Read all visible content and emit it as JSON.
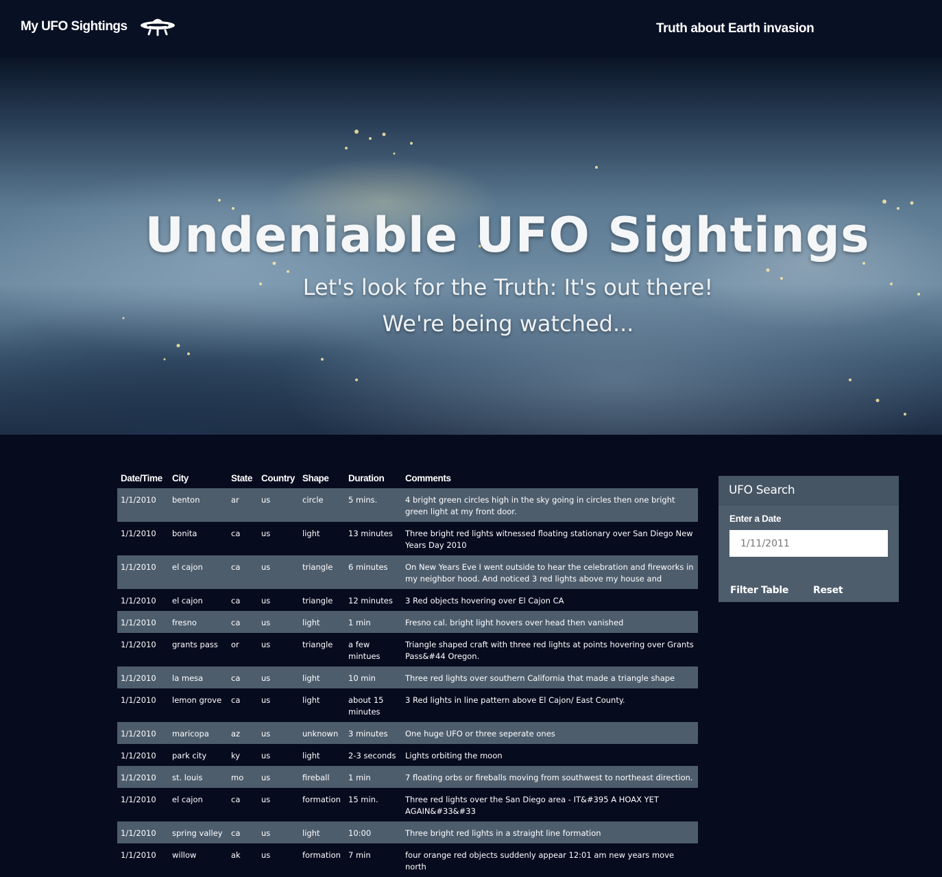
{
  "nav": {
    "brand": "My UFO Sightings",
    "link": "Truth about Earth invasion"
  },
  "hero": {
    "title": "Undeniable UFO Sightings",
    "subtitle": "Let's look for the Truth: It's out there!",
    "tagline": "We're being watched..."
  },
  "table": {
    "headers": [
      "Date/Time",
      "City",
      "State",
      "Country",
      "Shape",
      "Duration",
      "Comments"
    ],
    "rows": [
      [
        "1/1/2010",
        "benton",
        "ar",
        "us",
        "circle",
        "5 mins.",
        "4 bright green circles high in the sky going in circles then one bright green light at my front door."
      ],
      [
        "1/1/2010",
        "bonita",
        "ca",
        "us",
        "light",
        "13 minutes",
        "Three bright red lights witnessed floating stationary over San Diego New Years Day 2010"
      ],
      [
        "1/1/2010",
        "el cajon",
        "ca",
        "us",
        "triangle",
        "6 minutes",
        "On New Years Eve I went outside to hear the celebration and fireworks in my neighbor hood. And noticed 3 red lights above my house and"
      ],
      [
        "1/1/2010",
        "el cajon",
        "ca",
        "us",
        "triangle",
        "12 minutes",
        "3 Red objects hovering over El Cajon CA"
      ],
      [
        "1/1/2010",
        "fresno",
        "ca",
        "us",
        "light",
        "1 min",
        "Fresno cal. bright light hovers over head then vanished"
      ],
      [
        "1/1/2010",
        "grants pass",
        "or",
        "us",
        "triangle",
        "a few mintues",
        "Triangle shaped craft with three red lights at points hovering over Grants Pass&#44 Oregon."
      ],
      [
        "1/1/2010",
        "la mesa",
        "ca",
        "us",
        "light",
        "10 min",
        "Three red lights over southern California that made a triangle shape"
      ],
      [
        "1/1/2010",
        "lemon grove",
        "ca",
        "us",
        "light",
        "about 15 minutes",
        "3 Red lights in line pattern above El Cajon/ East County."
      ],
      [
        "1/1/2010",
        "maricopa",
        "az",
        "us",
        "unknown",
        "3 minutes",
        "One huge UFO or three seperate ones"
      ],
      [
        "1/1/2010",
        "park city",
        "ky",
        "us",
        "light",
        "2-3 seconds",
        "Lights orbiting the moon"
      ],
      [
        "1/1/2010",
        "st. louis",
        "mo",
        "us",
        "fireball",
        "1 min",
        "7 floating orbs or fireballs moving from southwest to northeast direction."
      ],
      [
        "1/1/2010",
        "el cajon",
        "ca",
        "us",
        "formation",
        "15 min.",
        "Three red lights over the San Diego area - IT&#395 A HOAX YET AGAIN&#33&#33"
      ],
      [
        "1/1/2010",
        "spring valley",
        "ca",
        "us",
        "light",
        "10:00",
        "Three bright red lights in a straight line formation"
      ],
      [
        "1/1/2010",
        "willow",
        "ak",
        "us",
        "formation",
        "7 min",
        "four orange red objects suddenly appear 12:01 am new years move north"
      ]
    ]
  },
  "search": {
    "title": "UFO Search",
    "label": "Enter a Date",
    "placeholder": "1/11/2011",
    "filter_label": "Filter Table",
    "reset_label": "Reset"
  }
}
